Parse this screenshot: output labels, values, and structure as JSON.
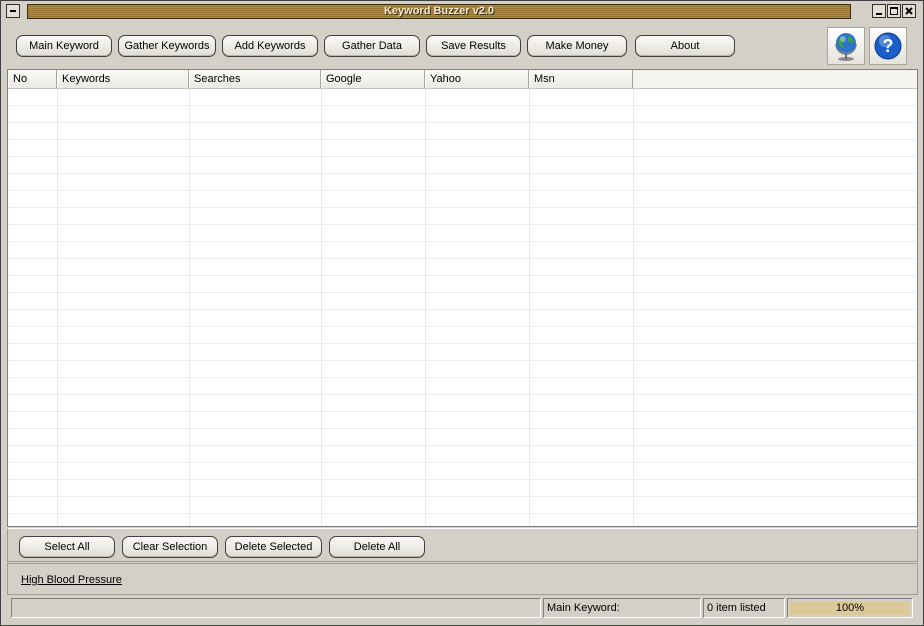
{
  "window": {
    "title": "Keyword Buzzer v2.0"
  },
  "toolbar": {
    "buttons": [
      {
        "label": "Main Keyword"
      },
      {
        "label": "Gather Keywords"
      },
      {
        "label": "Add Keywords"
      },
      {
        "label": "Gather Data"
      },
      {
        "label": "Save Results"
      },
      {
        "label": "Make Money"
      },
      {
        "label": "About"
      }
    ],
    "icons": [
      "globe-icon",
      "help-icon"
    ]
  },
  "table": {
    "columns": [
      "No",
      "Keywords",
      "Searches",
      "Google",
      "Yahoo",
      "Msn"
    ],
    "rows": []
  },
  "actions": {
    "buttons": [
      {
        "label": "Select All"
      },
      {
        "label": "Clear Selection"
      },
      {
        "label": "Delete Selected"
      },
      {
        "label": "Delete All"
      }
    ]
  },
  "footer": {
    "link": "High Blood Pressure"
  },
  "status": {
    "main_keyword_label": "Main Keyword:",
    "items_listed": "0 item listed",
    "progress_text": "100%",
    "progress_fraction": 1.0
  },
  "colors": {
    "title_bar": "#a88840",
    "progress": "#dcc99a",
    "window_bg": "#d4d0c8"
  }
}
